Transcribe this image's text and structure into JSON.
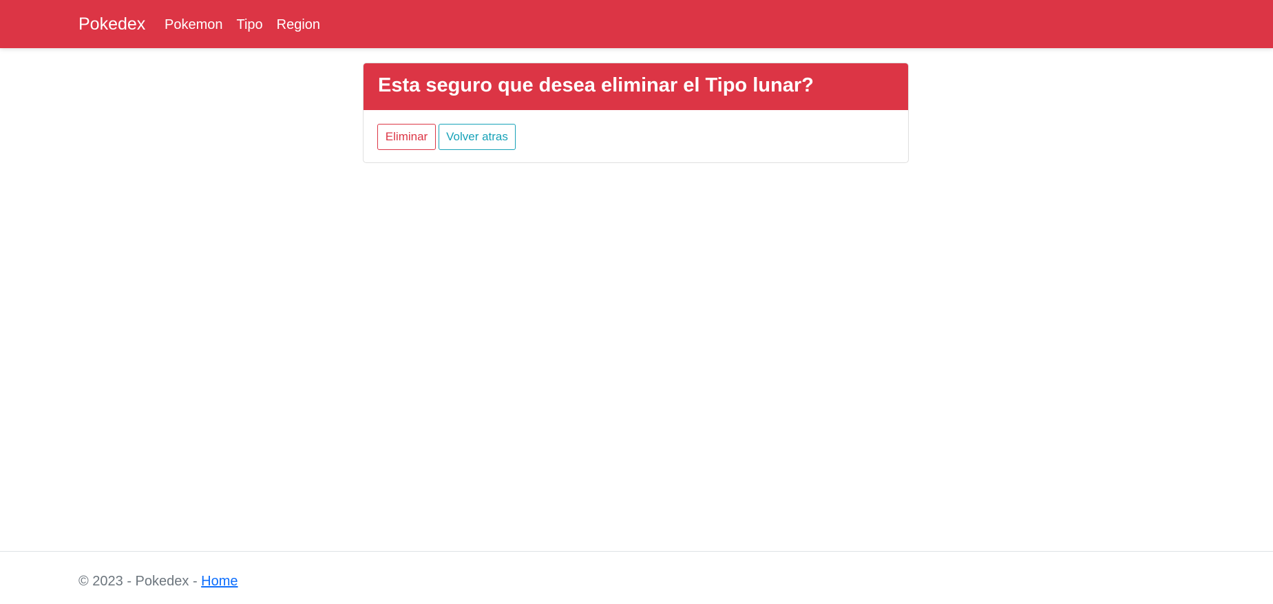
{
  "navbar": {
    "brand": "Pokedex",
    "links": [
      "Pokemon",
      "Tipo",
      "Region"
    ],
    "color": "#dc3545"
  },
  "card": {
    "title": "Esta seguro que desea eliminar el Tipo lunar?",
    "delete_label": "Eliminar",
    "back_label": "Volver atras"
  },
  "footer": {
    "text": "© 2023 - Pokedex - ",
    "link_label": "Home"
  }
}
